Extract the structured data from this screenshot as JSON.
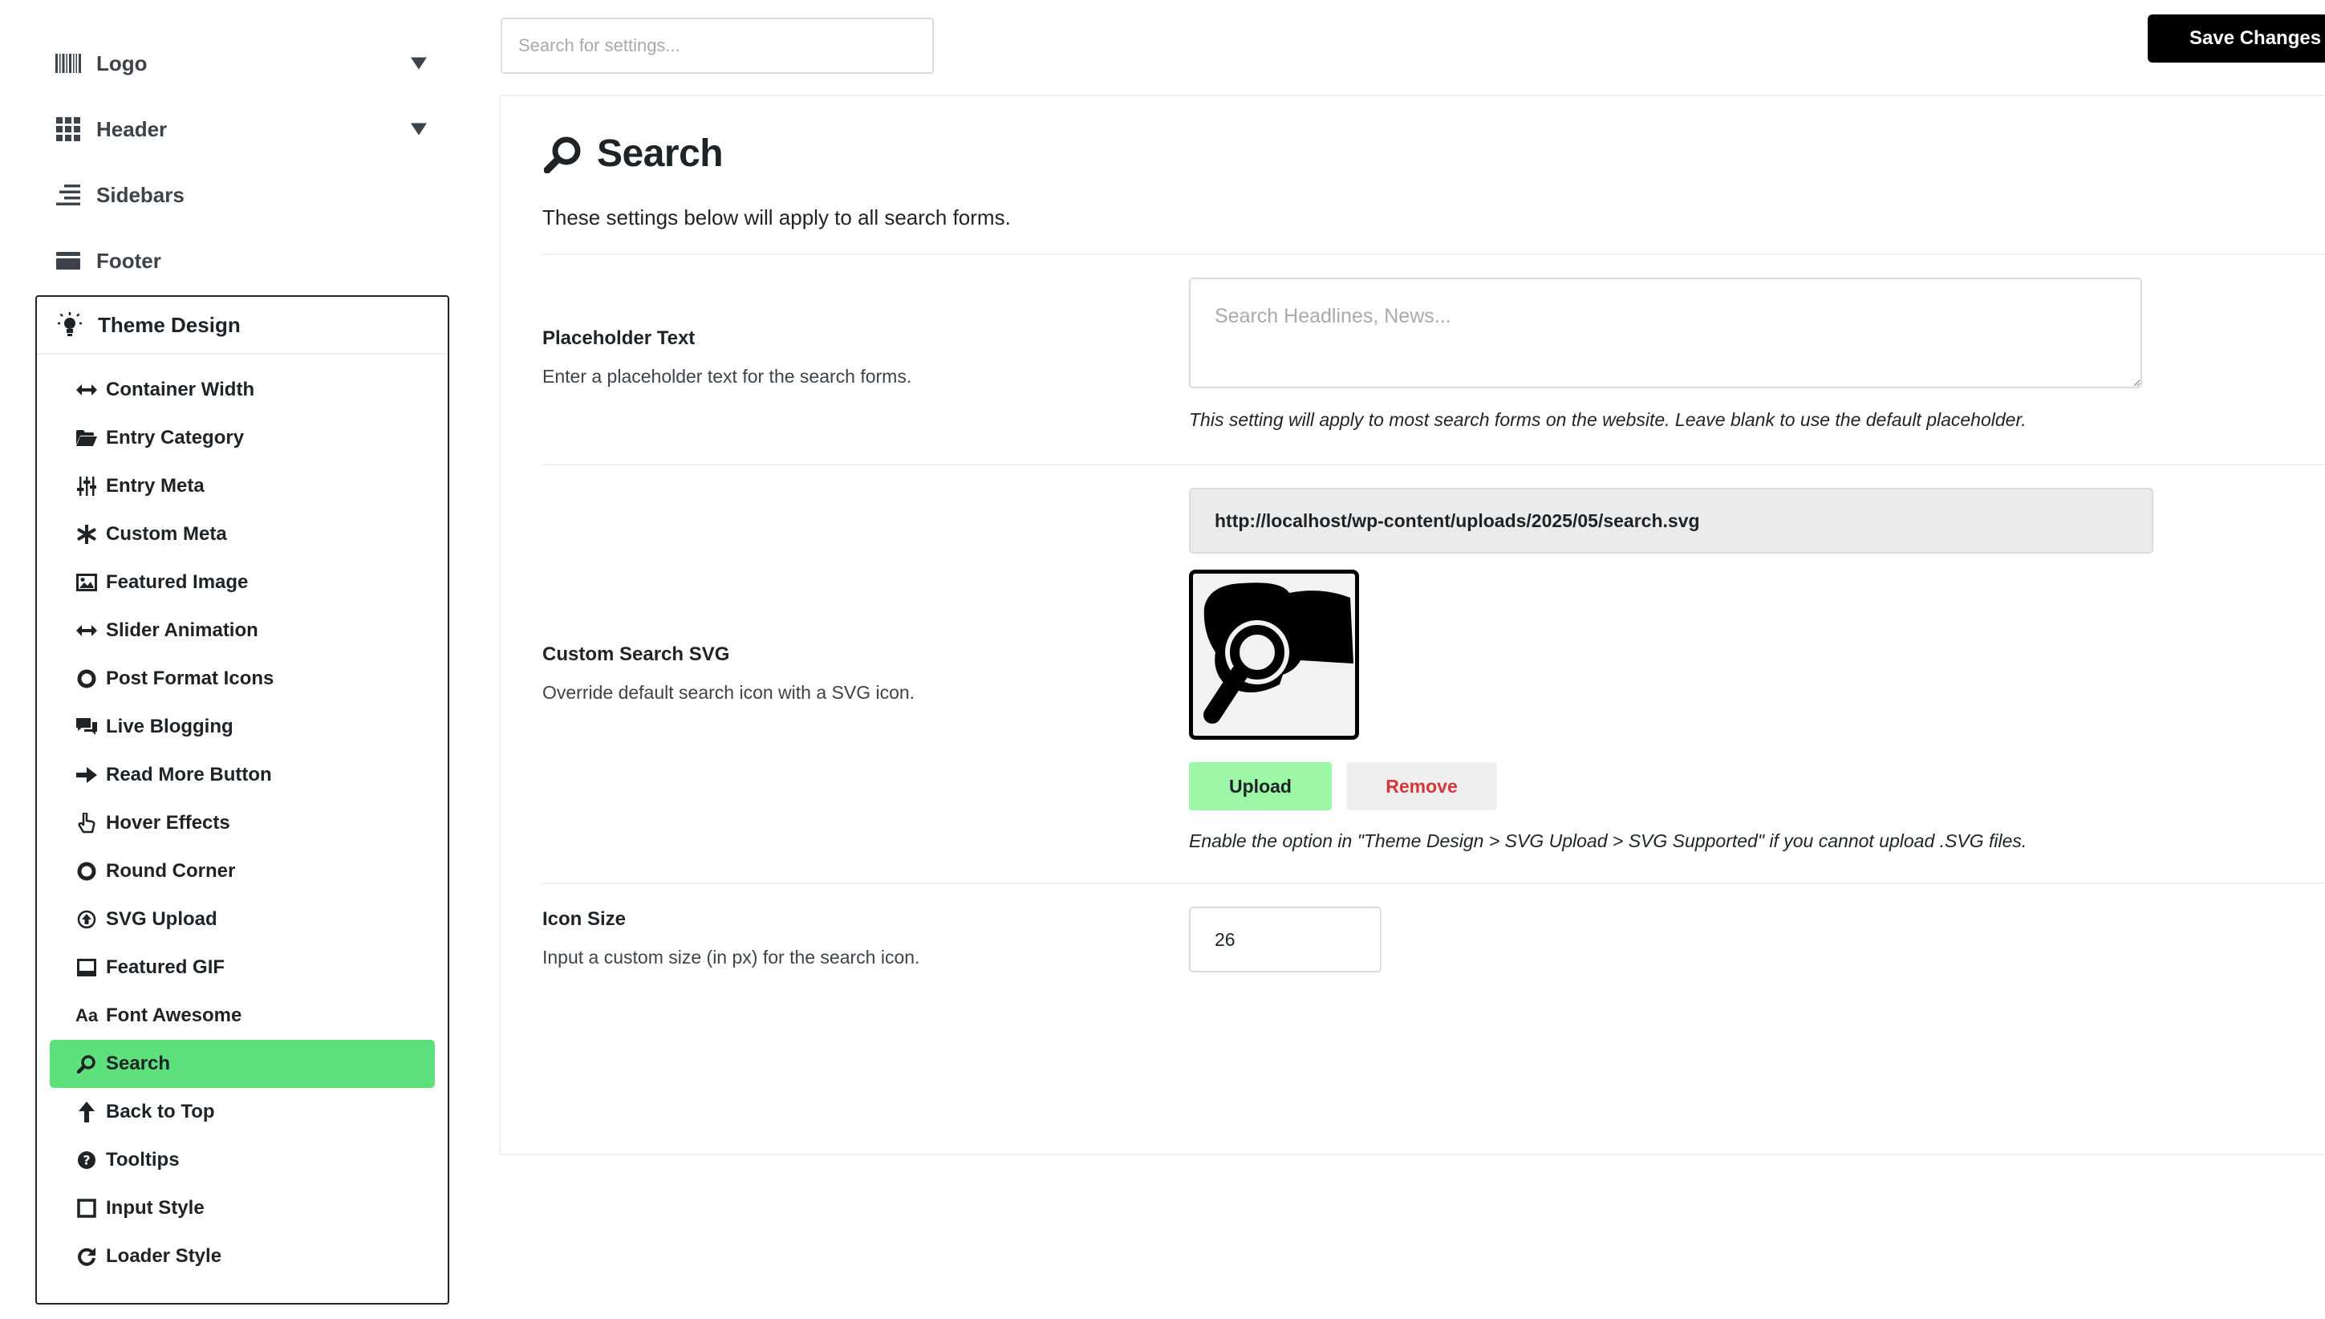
{
  "sidebar": {
    "top_items": [
      {
        "label": "Logo",
        "icon": "barcode-icon",
        "has_caret": true
      },
      {
        "label": "Header",
        "icon": "grid-icon",
        "has_caret": true
      },
      {
        "label": "Sidebars",
        "icon": "align-right-icon",
        "has_caret": false
      },
      {
        "label": "Footer",
        "icon": "credit-card-icon",
        "has_caret": false
      }
    ],
    "group": {
      "label": "Theme Design",
      "icon": "lightbulb-icon",
      "items": [
        {
          "label": "Container Width",
          "icon": "arrows-horizontal-icon"
        },
        {
          "label": "Entry Category",
          "icon": "folder-open-icon"
        },
        {
          "label": "Entry Meta",
          "icon": "sliders-icon"
        },
        {
          "label": "Custom Meta",
          "icon": "asterisk-icon"
        },
        {
          "label": "Featured Image",
          "icon": "image-icon"
        },
        {
          "label": "Slider Animation",
          "icon": "arrows-horizontal-icon"
        },
        {
          "label": "Post Format Icons",
          "icon": "circle-icon"
        },
        {
          "label": "Live Blogging",
          "icon": "comments-icon"
        },
        {
          "label": "Read More Button",
          "icon": "arrow-right-icon"
        },
        {
          "label": "Hover Effects",
          "icon": "hand-pointer-icon"
        },
        {
          "label": "Round Corner",
          "icon": "circle-icon"
        },
        {
          "label": "SVG Upload",
          "icon": "upload-circle-icon"
        },
        {
          "label": "Featured GIF",
          "icon": "window-icon"
        },
        {
          "label": "Font Awesome",
          "icon": "font-icon",
          "glyph": "Aa"
        },
        {
          "label": "Search",
          "icon": "search-icon",
          "active": true
        },
        {
          "label": "Back to Top",
          "icon": "arrow-up-icon"
        },
        {
          "label": "Tooltips",
          "icon": "question-circle-icon"
        },
        {
          "label": "Input Style",
          "icon": "square-icon"
        },
        {
          "label": "Loader Style",
          "icon": "redo-icon"
        }
      ]
    }
  },
  "topbar": {
    "search_placeholder": "Search for settings...",
    "save_label": "Save Changes"
  },
  "panel": {
    "title": "Search",
    "description": "These settings below will apply to all search forms.",
    "placeholder_setting": {
      "label": "Placeholder Text",
      "description": "Enter a placeholder text for the search forms.",
      "input_placeholder": "Search Headlines, News...",
      "value": "",
      "note": "This setting will apply to most search forms on the website. Leave blank to use the default placeholder."
    },
    "svg_setting": {
      "label": "Custom Search SVG",
      "description": "Override default search icon with a SVG icon.",
      "url": "http://localhost/wp-content/uploads/2025/05/search.svg",
      "upload_label": "Upload",
      "remove_label": "Remove",
      "note": "Enable the option in \"Theme Design > SVG Upload > SVG Supported\" if you cannot upload .SVG files."
    },
    "size_setting": {
      "label": "Icon Size",
      "description": "Input a custom size (in px) for the search icon.",
      "value": "26"
    }
  },
  "colors": {
    "active_item": "#5ee07c",
    "upload_button": "#9ef7a6",
    "remove_text": "#d63638",
    "save_button": "#000000"
  }
}
